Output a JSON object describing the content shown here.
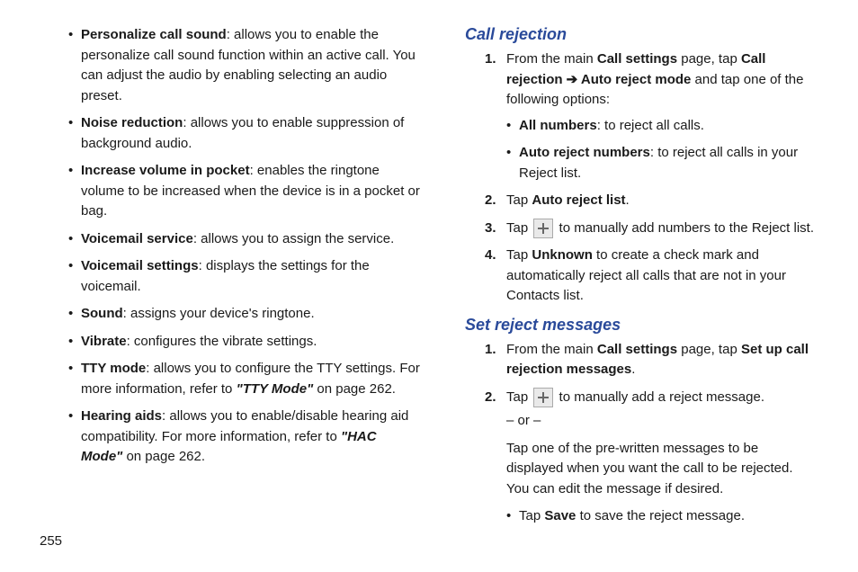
{
  "left": {
    "items": [
      {
        "bold": "Personalize call sound",
        "rest": ": allows you to enable the personalize call sound function within an active call. You can adjust the audio by enabling selecting an audio preset."
      },
      {
        "bold": "Noise reduction",
        "rest": ": allows you to enable suppression of background audio."
      },
      {
        "bold": "Increase volume in pocket",
        "rest": ": enables the ringtone volume to be increased when the device is in a pocket or bag."
      },
      {
        "bold": "Voicemail service",
        "rest": ": allows you to assign the service."
      },
      {
        "bold": "Voicemail settings",
        "rest": ": displays the settings for the voicemail."
      },
      {
        "bold": "Sound",
        "rest": ": assigns your device's ringtone."
      },
      {
        "bold": "Vibrate",
        "rest": ": configures the vibrate settings."
      },
      {
        "bold": "TTY mode",
        "rest_a": ": allows you to configure the TTY settings. For more information, refer to ",
        "ref": "\"TTY Mode\"",
        "rest_b": "  on page 262."
      },
      {
        "bold": "Hearing aids",
        "rest_a": ": allows you to enable/disable hearing aid compatibility. For more information, refer to ",
        "ref": "\"HAC Mode\"",
        "rest_b": "  on page 262."
      }
    ]
  },
  "right": {
    "sec1": {
      "title": "Call rejection",
      "steps": [
        {
          "num": "1.",
          "pre": "From the main ",
          "b1": "Call settings",
          "mid": " page, tap ",
          "b2": "Call rejection ➔ Auto reject mode",
          "post": " and tap one of the following options:",
          "sub": [
            {
              "bold": "All numbers",
              "rest": ": to reject all calls."
            },
            {
              "bold": "Auto reject numbers",
              "rest": ": to reject all calls in your Reject list."
            }
          ]
        },
        {
          "num": "2.",
          "pre": "Tap ",
          "b1": "Auto reject list",
          "post": "."
        },
        {
          "num": "3.",
          "pre": "Tap  ",
          "icon": true,
          "post": "  to manually add numbers to the Reject list."
        },
        {
          "num": "4.",
          "pre": "Tap ",
          "b1": "Unknown",
          "post": " to create a check mark and automatically reject all calls that are not in your Contacts list."
        }
      ]
    },
    "sec2": {
      "title": "Set reject messages",
      "steps": [
        {
          "num": "1.",
          "pre": "From the main ",
          "b1": "Call settings",
          "mid": " page, tap ",
          "b2": "Set up call rejection messages",
          "post": "."
        },
        {
          "num": "2.",
          "pre": "Tap  ",
          "icon": true,
          "post": "  to manually add a reject message.",
          "or": "– or –",
          "follow": "Tap one of the pre-written messages to be displayed when you want the call to be rejected. You can edit the message if desired.",
          "save_pre": "Tap ",
          "save_b": "Save",
          "save_post": " to save the reject message."
        }
      ]
    }
  },
  "pagenum": "255"
}
